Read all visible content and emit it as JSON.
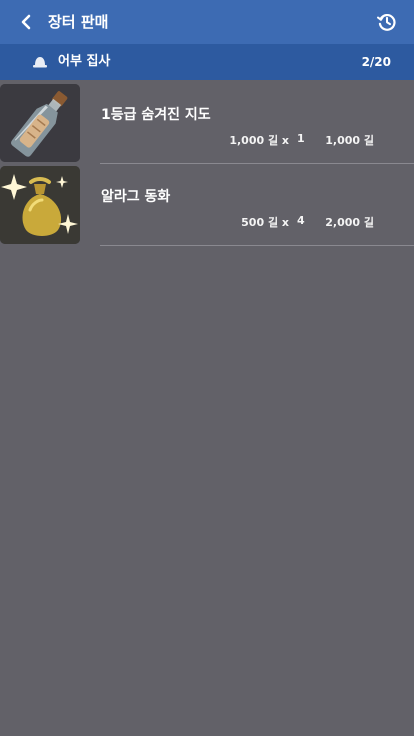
{
  "header": {
    "title": "장터 판매",
    "back_icon": "chevron-left-icon",
    "history_icon": "history-icon"
  },
  "retainer": {
    "icon": "bell-icon",
    "name": "어부 집사",
    "count": "2/20"
  },
  "items": [
    {
      "name": "1등급 숨겨진 지도",
      "unit_price": "1,000 길 x",
      "quantity": "1",
      "total": "1,000 길",
      "icon": "bottle-map-icon"
    },
    {
      "name": "알라그 동화",
      "unit_price": "500 길 x",
      "quantity": "4",
      "total": "2,000 길",
      "icon": "coin-pouch-icon"
    }
  ],
  "colors": {
    "header_bg": "#3d6bb3",
    "subheader_bg": "#2d5aa0",
    "page_bg": "#626168"
  }
}
